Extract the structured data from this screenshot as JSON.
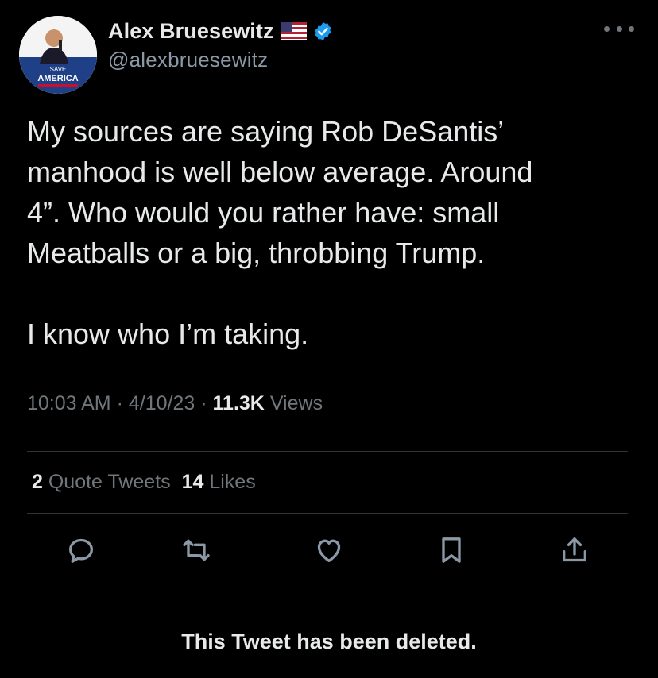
{
  "author": {
    "display_name": "Alex Bruesewitz",
    "handle": "@alexbruesewitz",
    "avatar_sign_text": "SAVE",
    "avatar_sign_title": "AMERICA",
    "flag_icon": "us-flag-icon",
    "verified_icon": "verified-badge-icon"
  },
  "tweet": {
    "text": "My sources are saying Rob DeSantis’\nmanhood is well below average. Around\n4”. Who would you rather have: small\nMeatballs or a big, throbbing Trump.\n\nI know who I’m taking.",
    "time": "10:03 AM",
    "date": "4/10/23",
    "views_count": "11.3K",
    "views_label": "Views",
    "separator": "·"
  },
  "stats": {
    "quote_count": "2",
    "quote_label": "Quote Tweets",
    "likes_count": "14",
    "likes_label": "Likes"
  },
  "actions": [
    "reply-icon",
    "retweet-icon",
    "like-icon",
    "bookmark-icon",
    "share-icon"
  ],
  "footer": {
    "deleted_notice": "This Tweet has been deleted."
  },
  "colors": {
    "background": "#000000",
    "text": "#e7e9ea",
    "secondary": "#71767b",
    "verified": "#1d9bf0",
    "icon": "#8b98a5"
  }
}
